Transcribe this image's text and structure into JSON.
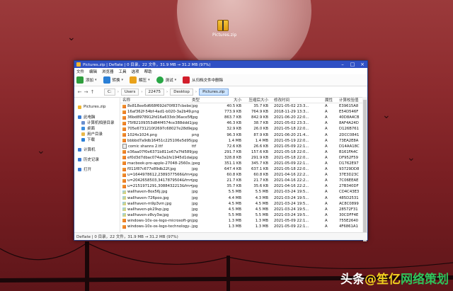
{
  "desktop": {
    "icon_label": "Pictures.zip",
    "watermark_prefix": "头条",
    "watermark_mid": "@笙亿",
    "watermark_end": "网络策划"
  },
  "window": {
    "title": "Pictures.zip | Deflate | 0 目录，22 文件，31.9 MB → 31.2 MB (97%)",
    "menu": [
      "文件",
      "编辑",
      "浏览器",
      "工具",
      "选项",
      "帮助"
    ],
    "toolbar": [
      {
        "label": "添加",
        "icon": "add-icon",
        "color": "#2f9e3d"
      },
      {
        "label": "转换",
        "icon": "convert-icon",
        "color": "#2a7fd6"
      },
      {
        "label": "解压",
        "icon": "extract-icon",
        "color": "#e9a21a"
      },
      {
        "label": "测试",
        "icon": "test-icon",
        "color": "#28a745"
      },
      {
        "label": "从归档文件中删除",
        "icon": "delete-icon",
        "color": "#d21e2b"
      }
    ],
    "breadcrumb": [
      "C:",
      "Users",
      "22475",
      "Desktop",
      "Pictures.zip"
    ],
    "sidebar": [
      {
        "label": "Pictures.zip",
        "sub": false,
        "icon": "zip-icon",
        "color": "#f2b630"
      },
      {
        "gap": true
      },
      {
        "label": "此电脑",
        "sub": false,
        "icon": "computer-icon",
        "color": "#3a7bd5"
      },
      {
        "label": "计算机相册目录",
        "sub": true,
        "icon": "folder-icon",
        "color": "#6a8fcf"
      },
      {
        "label": "桌面",
        "sub": true,
        "icon": "desktop-icon",
        "color": "#3b8ee0"
      },
      {
        "label": "用户目录",
        "sub": true,
        "icon": "folder-icon",
        "color": "#e8b84a"
      },
      {
        "label": "下载",
        "sub": true,
        "icon": "download-icon",
        "color": "#2a7fd6"
      },
      {
        "gap": true
      },
      {
        "label": "计算机",
        "sub": false,
        "icon": "computer-icon",
        "color": "#3a7bd5"
      },
      {
        "gap": true
      },
      {
        "label": "历史记录",
        "sub": false,
        "icon": "history-icon",
        "color": "#3a7bd5"
      },
      {
        "gap": true
      },
      {
        "label": "打开",
        "sub": false,
        "icon": "open-icon",
        "color": "#3a7bd5"
      }
    ],
    "columns": {
      "name": "名称",
      "type": "类型",
      "size": "大小",
      "packed": "压缩后大小",
      "modified": "修改时间",
      "attr": "属性",
      "crc": "计算校验值"
    },
    "files": [
      {
        "name": "8e818ee6d668f692d70f837cbebe1...",
        "type": "jpg",
        "size": "40.5 KB",
        "packed": "35.7 KB",
        "modified": "2021-05-02 23:3...",
        "attr": "A",
        "crc": "E39615A8",
        "icon": "img"
      },
      {
        "name": "16af362f-54bf-4ad1-b020-3a2b49...",
        "type": "png",
        "size": "773.9 KB",
        "packed": "764.9 KB",
        "modified": "2018-11-29 13:3...",
        "attr": "A",
        "crc": "E54D546F",
        "icon": "img"
      },
      {
        "name": "36bd8978912fd16a633dc36ace5fb...",
        "type": "jpg",
        "size": "863.7 KB",
        "packed": "842.9 KB",
        "modified": "2021-06-20 22:0...",
        "attr": "A",
        "crc": "40D8A4CB",
        "icon": "img"
      },
      {
        "name": "75f82109353d84f4574ce388ddd1...",
        "type": "jpg",
        "size": "46.3 KB",
        "packed": "38.7 KB",
        "modified": "2021-05-02 23:3...",
        "attr": "A",
        "crc": "8AF4A24D",
        "icon": "img"
      },
      {
        "name": "705e6731210f2697c68027e28d9e...",
        "type": "jpg",
        "size": "32.9 KB",
        "packed": "26.0 KB",
        "modified": "2021-05-18 22:0...",
        "attr": "A",
        "crc": "D126B761",
        "icon": "img"
      },
      {
        "name": "1024x1024.png",
        "type": "png",
        "size": "96.3 KB",
        "packed": "87.9 KB",
        "modified": "2021-06-20 21:4...",
        "attr": "A",
        "crc": "2DCC0841",
        "icon": "img"
      },
      {
        "name": "bbbbd7a9db16451c225106e5d958...",
        "type": "jpg",
        "size": "1.4 MB",
        "packed": "1.4 MB",
        "modified": "2021-05-19 22:0...",
        "attr": "A",
        "crc": "73EA2E8A",
        "icon": "img"
      },
      {
        "name": "comic shanns 2.ttf",
        "type": "ttf",
        "size": "72.6 KB",
        "packed": "26.6 KB",
        "modified": "2021-05-09 22:1...",
        "attr": "A",
        "crc": "D14AA18C",
        "icon": "txt"
      },
      {
        "name": "e36aa07f0e6371b811e67a7fd5897...",
        "type": "jpg",
        "size": "291.7 KB",
        "packed": "157.6 KB",
        "modified": "2021-05-18 22:0...",
        "attr": "A",
        "crc": "B161FA4C",
        "icon": "img"
      },
      {
        "name": "ef0d3d7dbac074a3a1fe1945d1da8...",
        "type": "jpg",
        "size": "328.8 KB",
        "packed": "291.9 KB",
        "modified": "2021-05-18 22:0...",
        "attr": "A",
        "crc": "DF952F59",
        "icon": "img"
      },
      {
        "name": "macbook-pro-apple-27048-2560x...",
        "type": "jpeg",
        "size": "351.1 KB",
        "packed": "345.7 KB",
        "modified": "2021-05-09 22:1...",
        "attr": "A",
        "crc": "D1762E97",
        "icon": "img"
      },
      {
        "name": "f011f87c677e89db22f.jpg",
        "type": "jpg",
        "size": "647.4 KB",
        "packed": "637.1 KB",
        "modified": "2021-05-18 22:0...",
        "attr": "A",
        "crc": "93729DD8",
        "icon": "img"
      },
      {
        "name": "u=1644978612,2389377566&fm=2...",
        "type": "jpg",
        "size": "60.8 KB",
        "packed": "60.8 KB",
        "modified": "2021-04-16 22:2...",
        "attr": "A",
        "crc": "37E3D23C",
        "icon": "img"
      },
      {
        "name": "u=2042658503,3417879504&fm=2...",
        "type": "jpg",
        "size": "21.7 KB",
        "packed": "21.7 KB",
        "modified": "2021-04-16 22:2...",
        "attr": "A",
        "crc": "7C06EEAE",
        "icon": "img"
      },
      {
        "name": "u=2151971291,3088432213&fm=1...",
        "type": "jpg",
        "size": "35.7 KB",
        "packed": "35.6 KB",
        "modified": "2021-04-16 22:2...",
        "attr": "A",
        "crc": "27B340DF",
        "icon": "img"
      },
      {
        "name": "wallhaven-8ox56j.jpg",
        "type": "jpg",
        "size": "5.5 MB",
        "packed": "5.5 MB",
        "modified": "2021-03-24 19:5...",
        "attr": "A",
        "crc": "CD4C43E3",
        "icon": "pic"
      },
      {
        "name": "wallhaven-726poo.jpg",
        "type": "jpg",
        "size": "4.4 MB",
        "packed": "4.3 MB",
        "modified": "2021-03-24 19:5...",
        "attr": "A",
        "crc": "485D2531",
        "icon": "pic"
      },
      {
        "name": "wallhaven-m9p3vm.jpg",
        "type": "jpg",
        "size": "4.5 MB",
        "packed": "4.5 MB",
        "modified": "2021-03-24 19:5...",
        "attr": "A",
        "crc": "AC8C0899",
        "icon": "pic"
      },
      {
        "name": "wallhaven-pk29vp.jpg",
        "type": "jpg",
        "size": "4.5 MB",
        "packed": "4.5 MB",
        "modified": "2021-03-24 19:5...",
        "attr": "A",
        "crc": "28572F31",
        "icon": "pic"
      },
      {
        "name": "wallhaven-z8vy3w.jpg",
        "type": "jpg",
        "size": "5.5 MB",
        "packed": "5.5 MB",
        "modified": "2021-03-24 19:5...",
        "attr": "A",
        "crc": "30CDFF4E",
        "icon": "pic"
      },
      {
        "name": "windows-10x-os-logo-microsoft-gradi...",
        "type": "jpg",
        "size": "1.3 MB",
        "packed": "1.3 MB",
        "modified": "2021-05-09 22:1...",
        "attr": "A",
        "crc": "755E2640",
        "icon": "img"
      },
      {
        "name": "windows-10x-os-logo-technology-...",
        "type": "jpg",
        "size": "1.3 MB",
        "packed": "1.3 MB",
        "modified": "2021-05-09 22:1...",
        "attr": "A",
        "crc": "4F6861A1",
        "icon": "img"
      }
    ],
    "status": "Deflate | 0 目录，22 文件，31.9 MB → 31.2 MB (97%)"
  }
}
